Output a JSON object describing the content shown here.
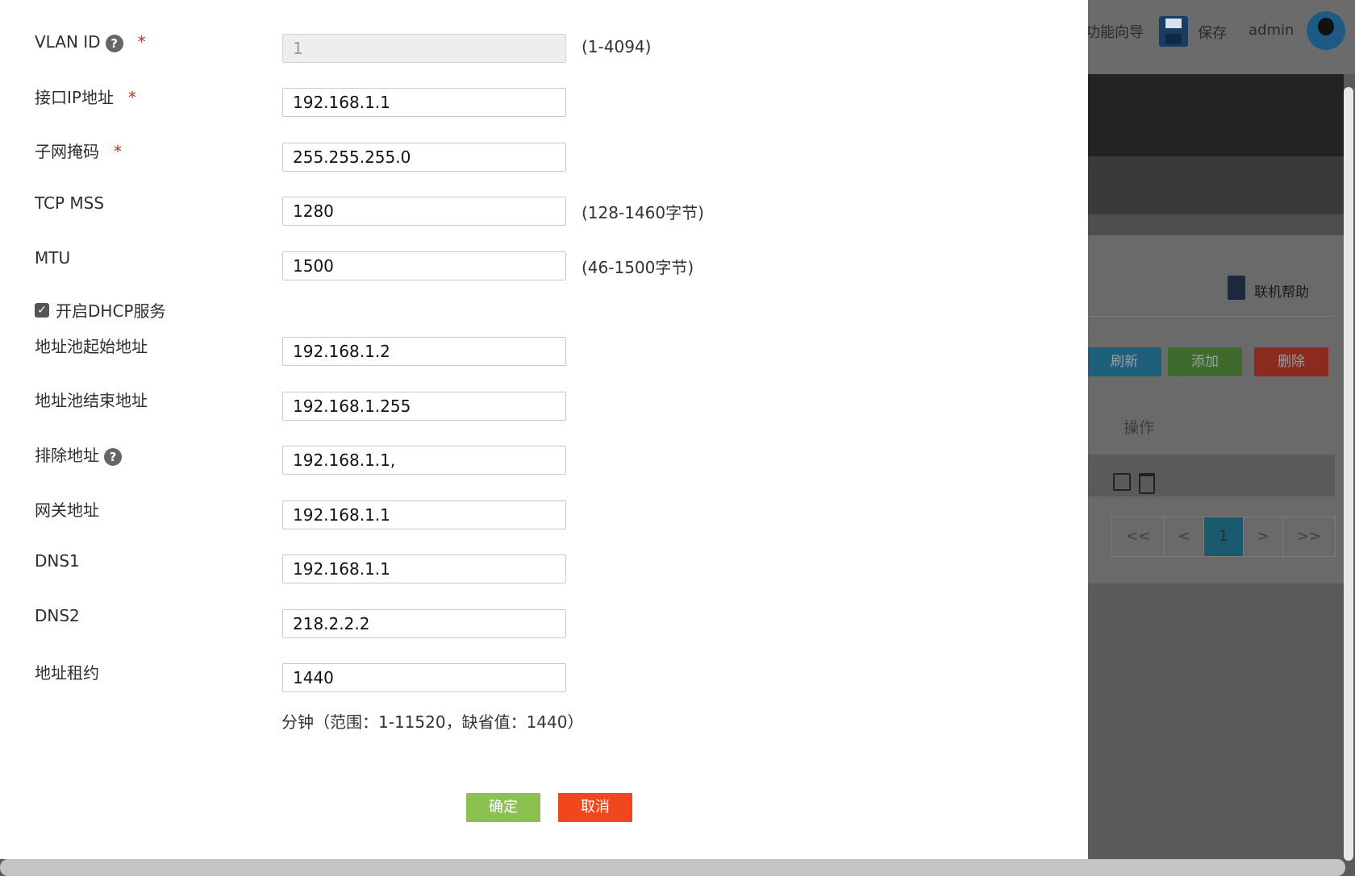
{
  "header": {
    "wizard_label": "功能向导",
    "save_label": "保存",
    "user_label": "admin"
  },
  "background_page": {
    "help_label": "联机帮助",
    "buttons": {
      "refresh": "刷新",
      "add": "添加",
      "delete": "删除"
    },
    "column_header": "操作",
    "pager": {
      "first": "<<",
      "prev": "<",
      "current": "1",
      "next": ">",
      "last": ">>"
    }
  },
  "form": {
    "vlan_id": {
      "label": "VLAN ID",
      "value": "1",
      "hint": "(1-4094)",
      "required": true
    },
    "interface_ip": {
      "label": "接口IP地址",
      "value": "192.168.1.1",
      "required": true
    },
    "subnet_mask": {
      "label": "子网掩码",
      "value": "255.255.255.0",
      "required": true
    },
    "tcp_mss": {
      "label": "TCP MSS",
      "value": "1280",
      "hint": "(128-1460字节)"
    },
    "mtu": {
      "label": "MTU",
      "value": "1500",
      "hint": "(46-1500字节)"
    },
    "dhcp_enabled": {
      "label": "开启DHCP服务",
      "checked": true
    },
    "pool_start": {
      "label": "地址池起始地址",
      "value": "192.168.1.2"
    },
    "pool_end": {
      "label": "地址池结束地址",
      "value": "192.168.1.255"
    },
    "exclude": {
      "label": "排除地址",
      "value": "192.168.1.1,"
    },
    "gateway": {
      "label": "网关地址",
      "value": "192.168.1.1"
    },
    "dns1": {
      "label": "DNS1",
      "value": "192.168.1.1"
    },
    "dns2": {
      "label": "DNS2",
      "value": "218.2.2.2"
    },
    "lease": {
      "label": "地址租约",
      "value": "1440",
      "note": "分钟（范围：1-11520，缺省值：1440）"
    }
  },
  "actions": {
    "confirm": "确定",
    "cancel": "取消"
  },
  "colors": {
    "confirm": "#8cc151",
    "cancel": "#f1471f",
    "required": "#d8281f"
  }
}
